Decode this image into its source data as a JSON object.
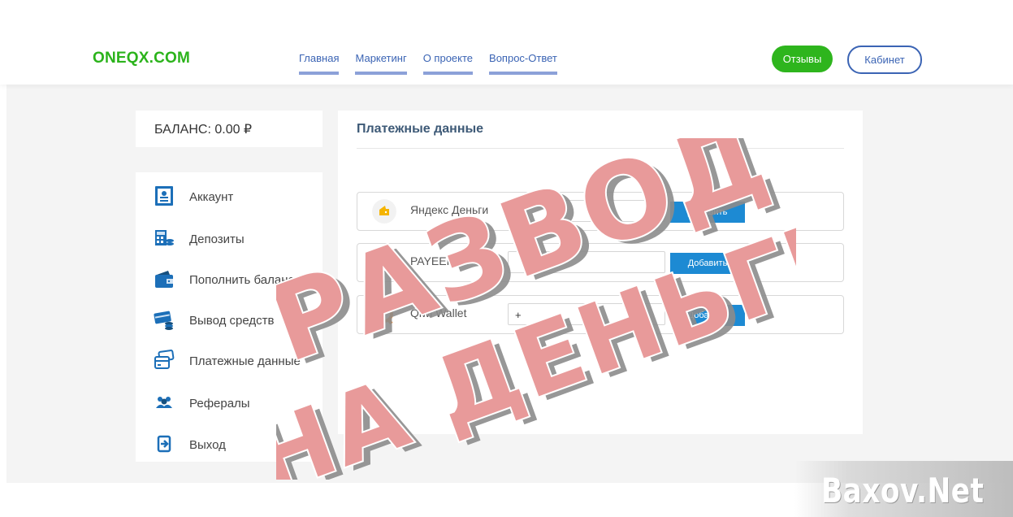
{
  "header": {
    "logo": "ONEQX.COM",
    "nav": [
      "Главная",
      "Маркетинг",
      "О проекте",
      "Вопрос-Ответ"
    ],
    "reviews_button": "Отзывы",
    "cabinet_button": "Кабинет"
  },
  "balance": {
    "label": "БАЛАНС: 0.00 ₽"
  },
  "sidebar": {
    "items": [
      {
        "label": "Аккаунт",
        "icon": "account-card-icon"
      },
      {
        "label": "Депозиты",
        "icon": "calculator-icon"
      },
      {
        "label": "Пополнить баланс",
        "icon": "wallet-icon"
      },
      {
        "label": "Вывод средств",
        "icon": "card-coins-icon"
      },
      {
        "label": "Платежные данные",
        "icon": "payment-cards-icon"
      },
      {
        "label": "Рефералы",
        "icon": "users-icon"
      },
      {
        "label": "Выход",
        "icon": "logout-icon"
      }
    ]
  },
  "main": {
    "title": "Платежные данные",
    "methods": [
      {
        "name": "Яндекс Деньги",
        "value": "",
        "button": "Добавить",
        "icon": "yandex-money-icon"
      },
      {
        "name": "PAYEER",
        "value": "",
        "button": "Добавить",
        "icon": "payeer-icon"
      },
      {
        "name": "Qiwi Wallet",
        "value": "+",
        "button": "Добавить",
        "icon": "qiwi-icon"
      }
    ]
  },
  "overlay": {
    "stamp_line1": "РАЗВОД",
    "stamp_line2": "НА ДЕНЬГИ",
    "watermark": "Baxov.Net"
  },
  "colors": {
    "brand_green": "#2bb31b",
    "nav_blue": "#3b64b4",
    "button_blue": "#1d8ad3",
    "stamp_red": "#e89a9a"
  }
}
